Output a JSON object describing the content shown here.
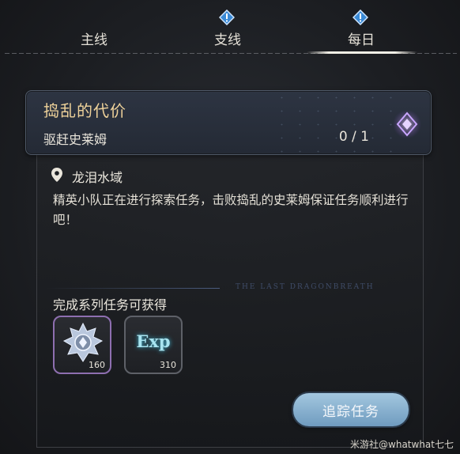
{
  "tabs": [
    {
      "label": "主线",
      "alert": false
    },
    {
      "label": "支线",
      "alert": true
    },
    {
      "label": "每日",
      "alert": true,
      "active": true
    }
  ],
  "quest": {
    "title": "捣乱的代价",
    "objective": "驱赶史莱姆",
    "progress": "0 / 1",
    "location": "龙泪水域",
    "description": "精英小队正在进行探索任务，击败捣乱的史莱姆保证任务顺利进行吧！",
    "banner_text": "THE LAST DRAGONBREATH"
  },
  "rewards": {
    "title": "完成系列任务可获得",
    "items": [
      {
        "icon": "medal-icon",
        "count": "160"
      },
      {
        "icon": "exp-icon",
        "label": "Exp",
        "count": "310"
      }
    ]
  },
  "track_button": "追踪任务",
  "credit": "米游社@whatwhat七七",
  "colors": {
    "title": "#efd29a",
    "accent": "#a77de0",
    "button": "#8fb5d3"
  }
}
